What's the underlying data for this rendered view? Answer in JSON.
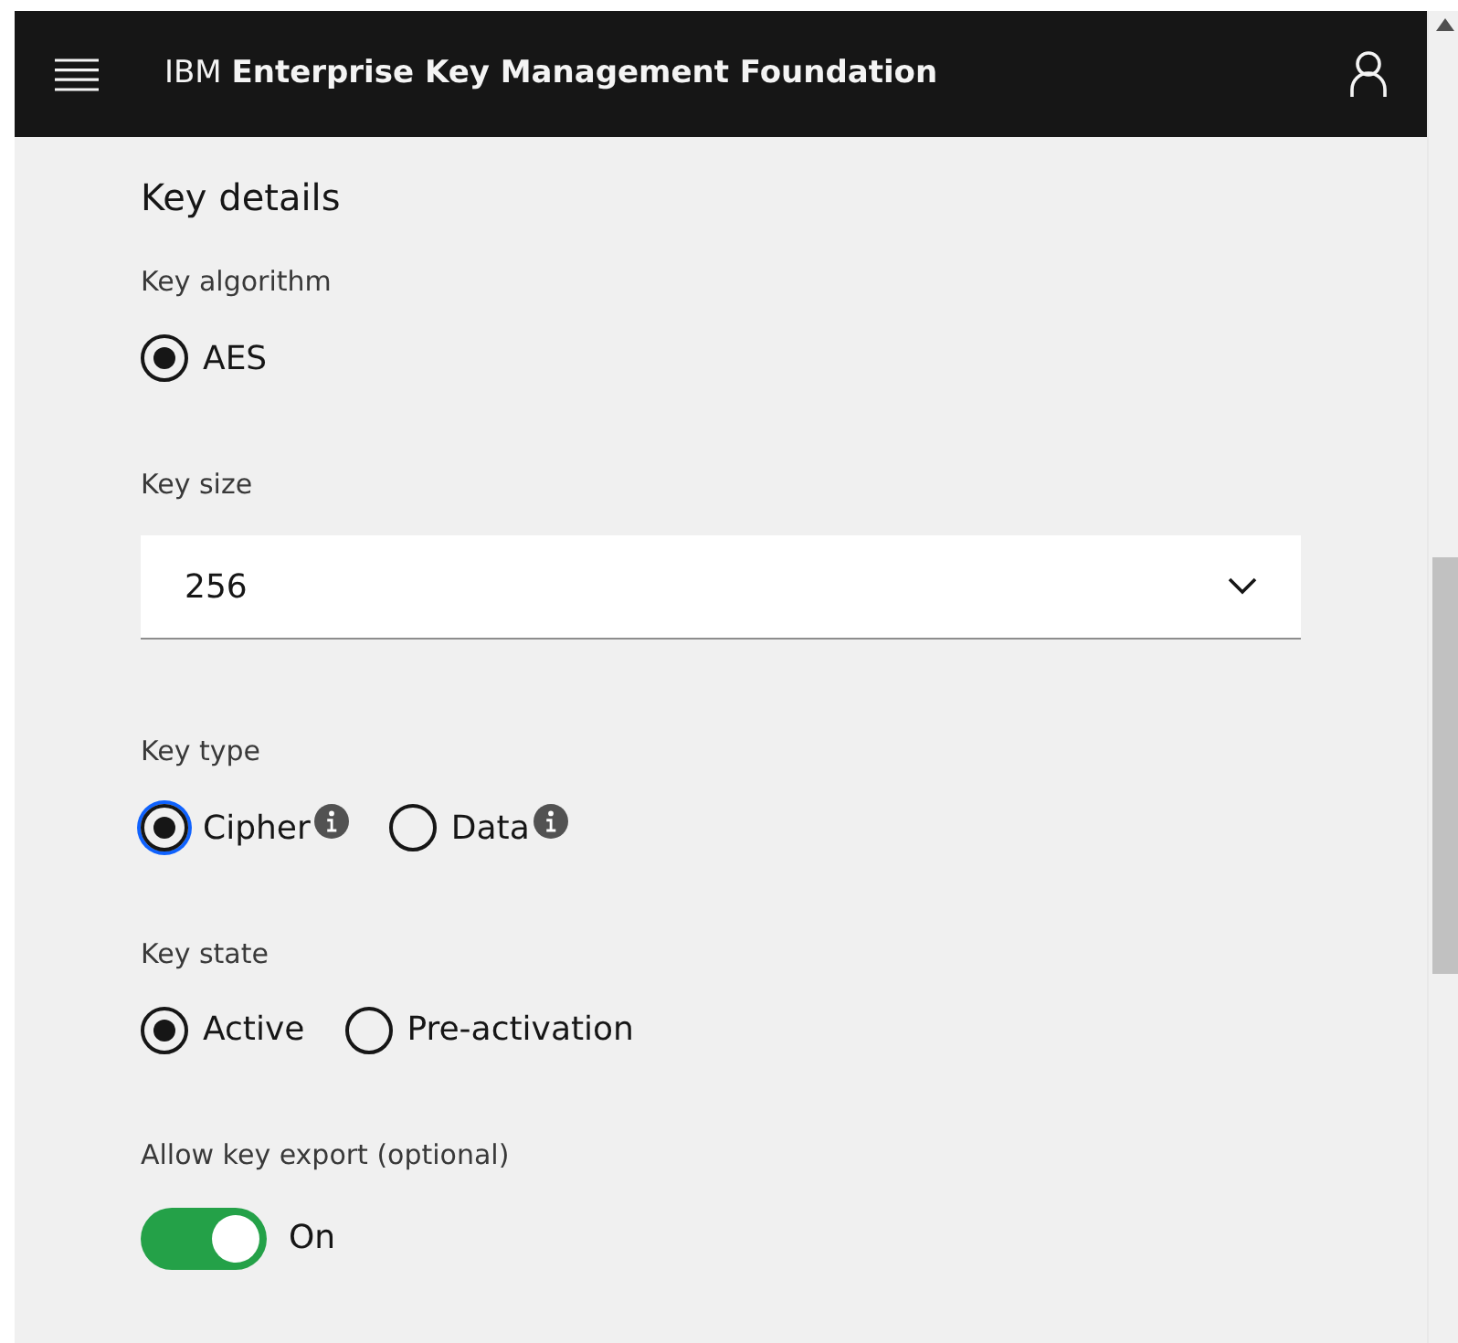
{
  "header": {
    "brand_prefix": "IBM",
    "brand_name": "Enterprise Key Management Foundation"
  },
  "section_title": "Key details",
  "fields": [
    {
      "kind": "radio",
      "label": "Key algorithm",
      "options": [
        {
          "label": "AES",
          "selected": true,
          "focused": false,
          "info": false
        }
      ]
    },
    {
      "kind": "select",
      "label": "Key size",
      "value": "256"
    },
    {
      "kind": "radio",
      "label": "Key type",
      "options": [
        {
          "label": "Cipher",
          "selected": true,
          "focused": true,
          "info": true
        },
        {
          "label": "Data",
          "selected": false,
          "focused": false,
          "info": true
        }
      ]
    },
    {
      "kind": "radio",
      "label": "Key state",
      "options": [
        {
          "label": "Active",
          "selected": true,
          "focused": false,
          "info": false
        },
        {
          "label": "Pre-activation",
          "selected": false,
          "focused": false,
          "info": false
        }
      ]
    },
    {
      "kind": "toggle",
      "label": "Allow key export (optional)",
      "on": true,
      "state_text": "On"
    }
  ]
}
